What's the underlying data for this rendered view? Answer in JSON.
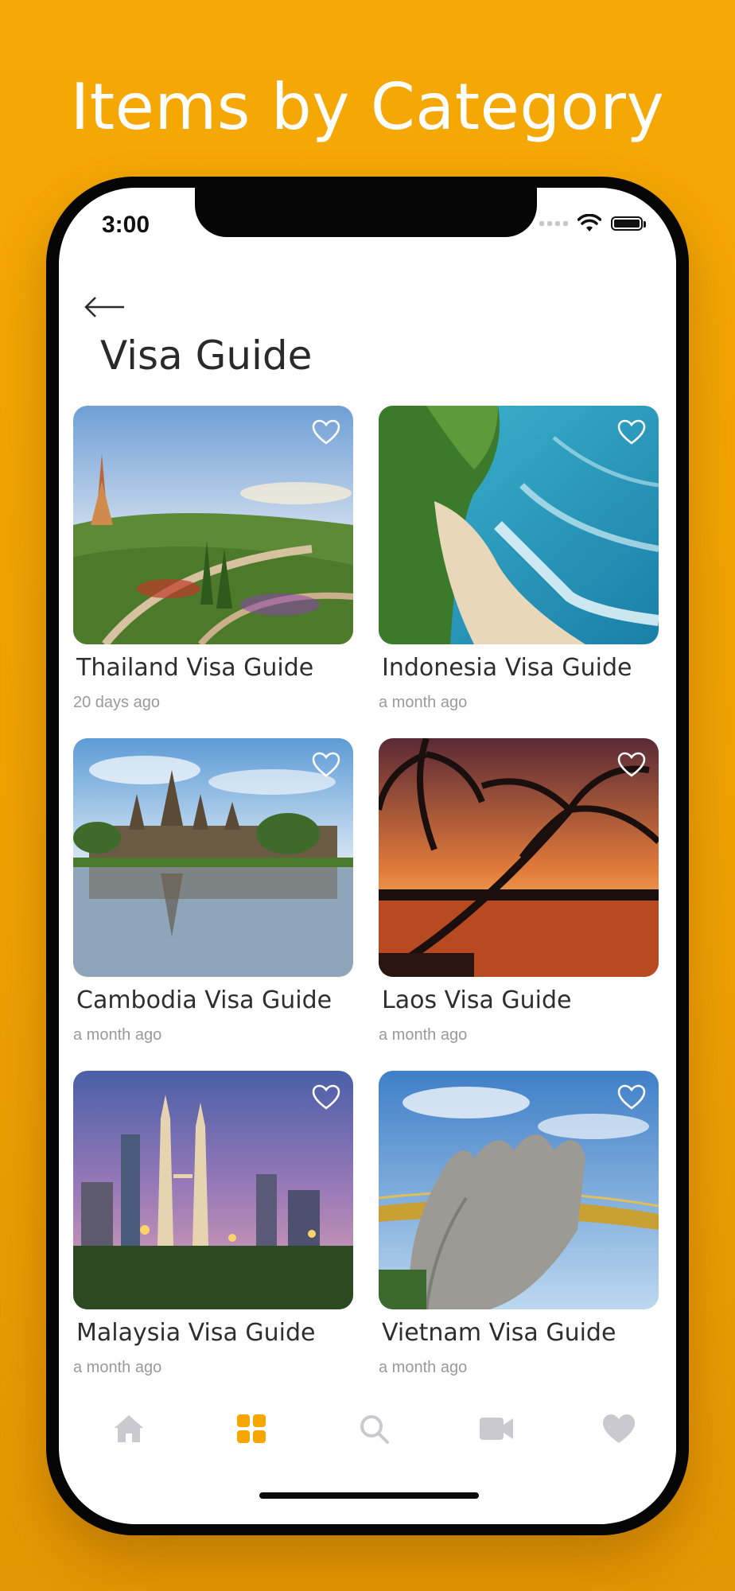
{
  "headline": "Items by Category",
  "status_bar": {
    "time": "3:00"
  },
  "header": {
    "title": "Visa Guide"
  },
  "colors": {
    "accent": "#F5A700",
    "inactive_tab": "#C9C9CF",
    "background": "#F6A804"
  },
  "items": [
    {
      "title": "Thailand Visa Guide",
      "time": "20 days ago",
      "image": "thailand-garden-pagoda"
    },
    {
      "title": "Indonesia Visa Guide",
      "time": "a month ago",
      "image": "indonesia-cliff-beach"
    },
    {
      "title": "Cambodia Visa Guide",
      "time": "a month ago",
      "image": "cambodia-angkor-wat"
    },
    {
      "title": "Laos Visa Guide",
      "time": "a month ago",
      "image": "laos-palm-sunset"
    },
    {
      "title": "Malaysia Visa Guide",
      "time": "a month ago",
      "image": "malaysia-petronas-towers"
    },
    {
      "title": "Vietnam Visa Guide",
      "time": "a month ago",
      "image": "vietnam-golden-bridge-hands"
    }
  ],
  "tabbar": [
    {
      "icon": "home-icon",
      "active": false
    },
    {
      "icon": "grid-icon",
      "active": true
    },
    {
      "icon": "search-icon",
      "active": false
    },
    {
      "icon": "video-icon",
      "active": false
    },
    {
      "icon": "heart-icon",
      "active": false
    }
  ]
}
